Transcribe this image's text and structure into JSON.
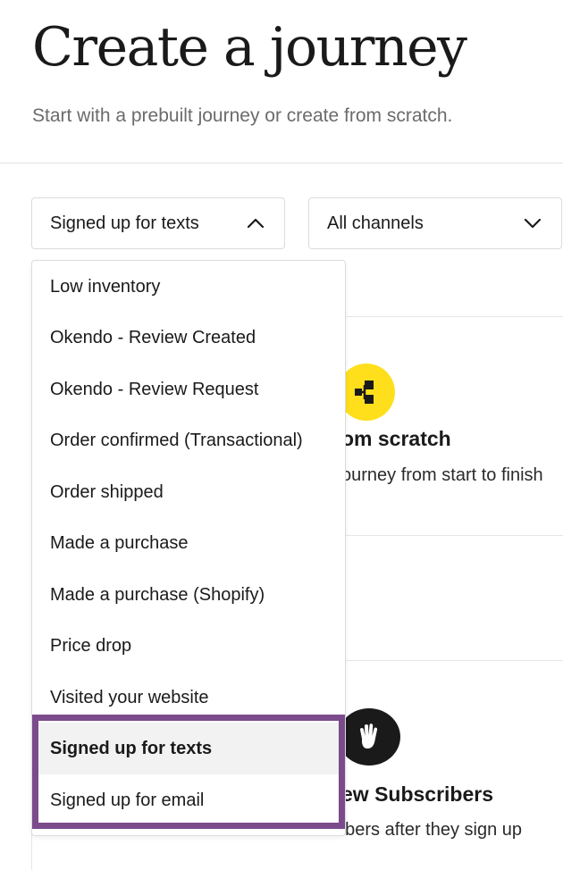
{
  "header": {
    "title": "Create a journey",
    "subtitle": "Start with a prebuilt journey or create from scratch."
  },
  "filters": {
    "trigger": {
      "value": "Signed up for texts",
      "icon": "chevron-up-icon",
      "open": true
    },
    "channel": {
      "value": "All channels",
      "icon": "chevron-down-icon"
    }
  },
  "cards": {
    "scratch": {
      "icon": "flow-diagram-icon",
      "icon_color": "#ffdf1b",
      "title": "om scratch",
      "description": "ourney from start to finish"
    },
    "welcome": {
      "icon": "waving-hand-icon",
      "icon_color": "#1a1a1a",
      "title": "ew Subscribers",
      "description": "Welcome new subscribers after they sign up"
    }
  },
  "dropdown": {
    "selected_index": 9,
    "items": [
      {
        "label": "Low inventory"
      },
      {
        "label": "Okendo - Review Created"
      },
      {
        "label": "Okendo - Review Request"
      },
      {
        "label": "Order confirmed (Transactional)"
      },
      {
        "label": "Order shipped"
      },
      {
        "label": "Made a purchase"
      },
      {
        "label": "Made a purchase (Shopify)"
      },
      {
        "label": "Price drop"
      },
      {
        "label": "Visited your website"
      },
      {
        "label": "Signed up for texts"
      },
      {
        "label": "Signed up for email"
      }
    ]
  },
  "annotation": {
    "highlight_color": "#7b4b8c"
  }
}
